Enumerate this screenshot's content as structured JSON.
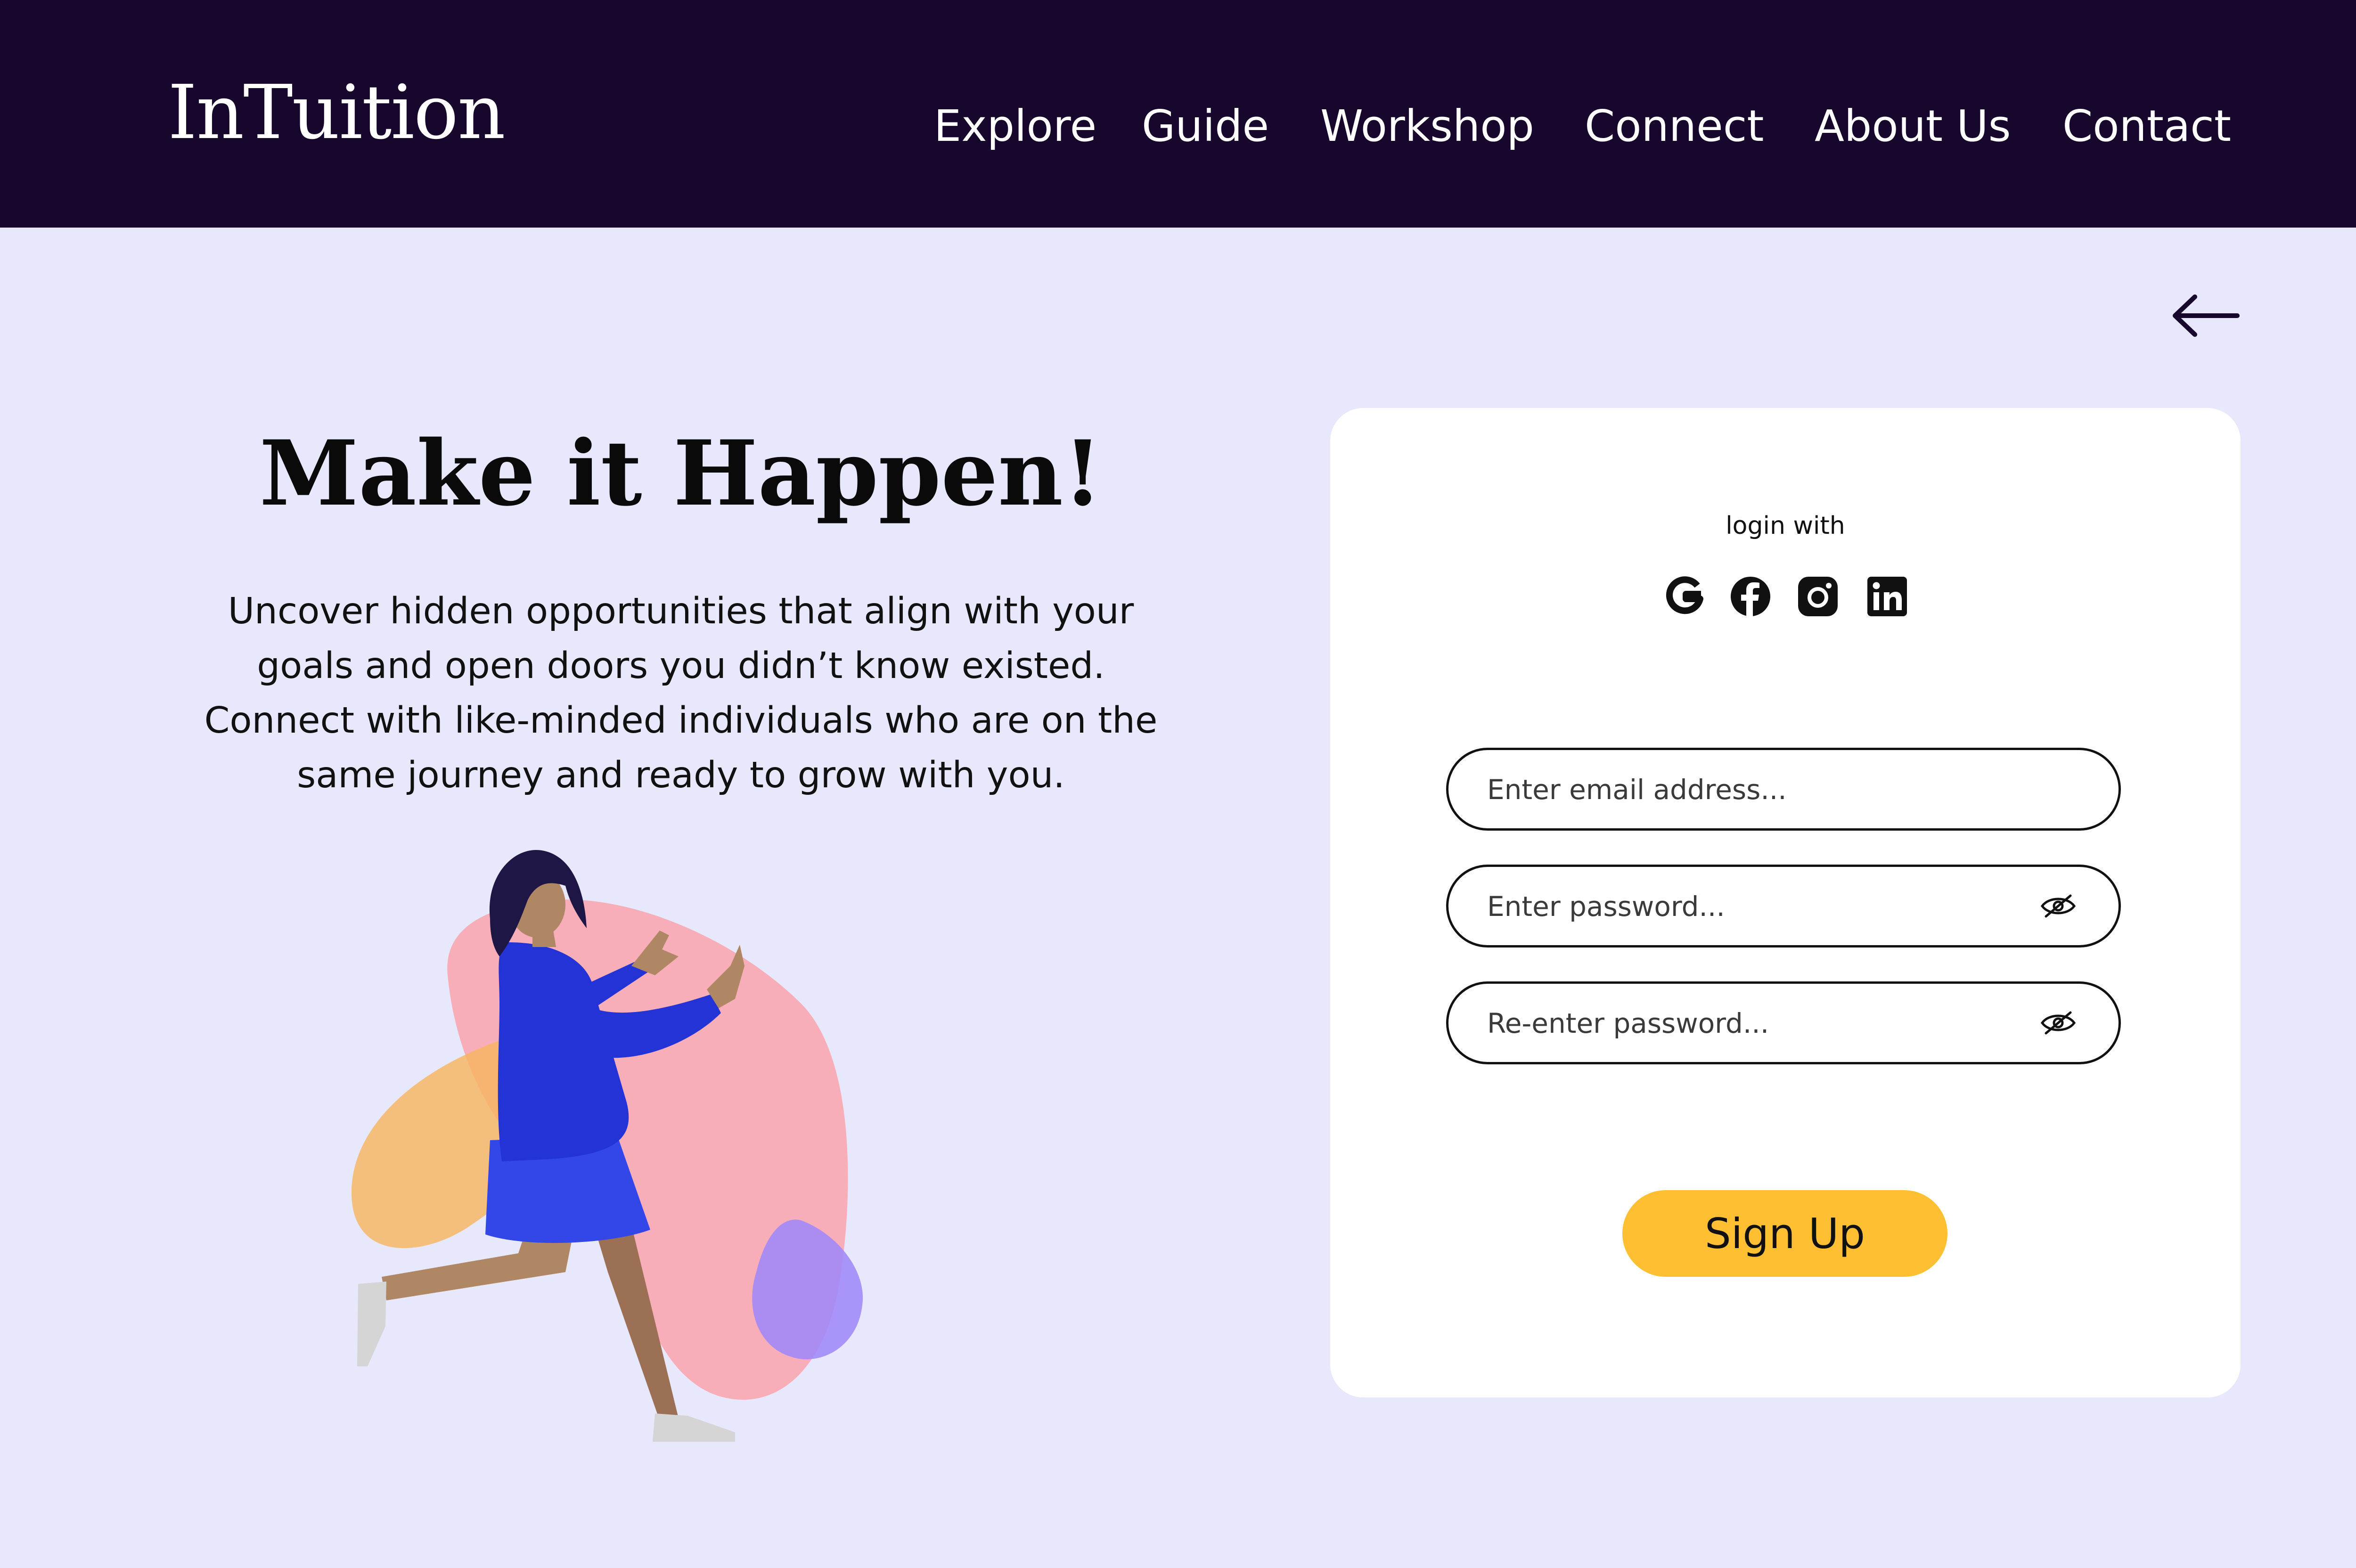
{
  "header": {
    "brand": "InTuition",
    "nav": [
      "Explore",
      "Guide",
      "Workshop",
      "Connect",
      "About Us",
      "Contact"
    ]
  },
  "hero": {
    "headline": "Make it Happen!",
    "description": "Uncover hidden opportunities that align with your goals and open doors you didn’t know existed. Connect with like-minded individuals who are on the same journey and ready to grow with you."
  },
  "signup_card": {
    "login_with": "login with",
    "social_icons": [
      "google-icon",
      "facebook-icon",
      "instagram-icon",
      "linkedin-icon"
    ],
    "email_placeholder": "Enter email address...",
    "password_placeholder": "Enter password...",
    "reenter_placeholder": "Re-enter password...",
    "submit_label": "Sign Up"
  },
  "colors": {
    "header_bg": "#18072C",
    "page_bg": "#E8E8FD",
    "card_bg": "#FFFFFF",
    "accent": "#FFBF33"
  }
}
